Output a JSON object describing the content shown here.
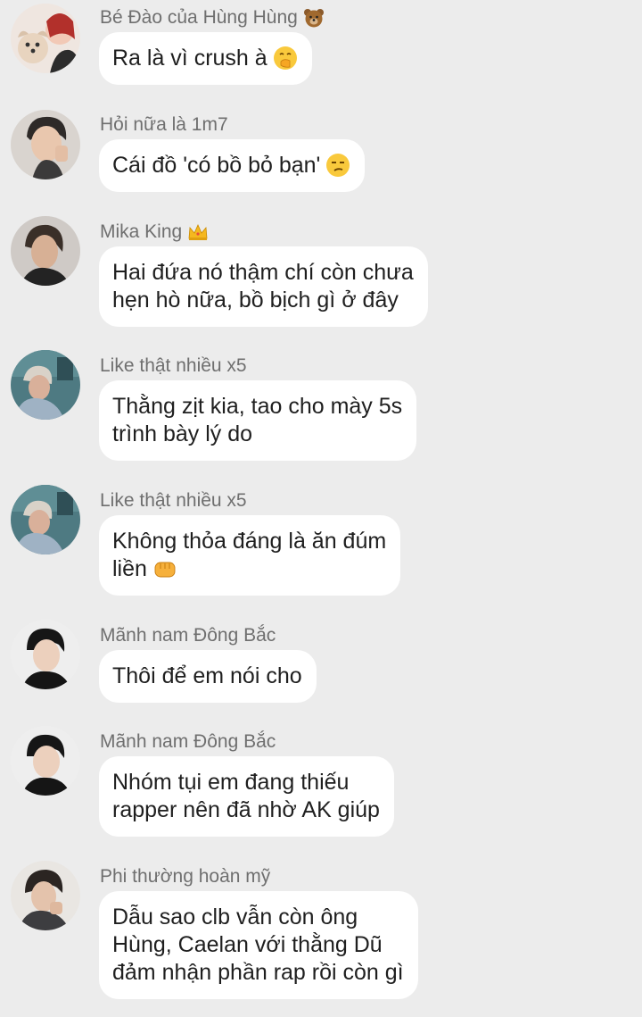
{
  "messages": [
    {
      "sender": "Bé Đào của Hùng Hùng",
      "sender_emoji": "bear-face-icon",
      "lines": [
        "Ra là vì crush à"
      ],
      "trailing_emoji": "face-with-hand-over-mouth-icon"
    },
    {
      "sender": "Hỏi nữa là 1m7",
      "lines": [
        "Cái đồ 'có bồ bỏ bạn'"
      ],
      "trailing_emoji": "unamused-face-icon"
    },
    {
      "sender": "Mika King",
      "sender_emoji": "crown-icon",
      "lines": [
        "Hai đứa nó thậm chí còn chưa",
        "hẹn hò nữa, bồ bịch gì ở đây"
      ]
    },
    {
      "sender": "Like thật nhiều x5",
      "lines": [
        "Thằng zịt kia, tao cho mày 5s",
        "trình bày lý do"
      ]
    },
    {
      "sender": "Like thật nhiều x5",
      "lines": [
        "Không thỏa đáng là ăn đúm",
        "liền"
      ],
      "trailing_emoji": "oncoming-fist-icon"
    },
    {
      "sender": "Mãnh nam Đông Bắc",
      "lines": [
        "Thôi để em nói cho"
      ]
    },
    {
      "sender": "Mãnh nam Đông Bắc",
      "lines": [
        "Nhóm tụi em đang thiếu",
        "rapper nên đã nhờ AK giúp"
      ]
    },
    {
      "sender": "Phi thường hoàn mỹ",
      "lines": [
        "Dẫu sao clb vẫn còn ông",
        "Hùng, Caelan với thằng Dũ",
        "đảm nhận phần rap rồi còn gì"
      ]
    }
  ],
  "colors": {
    "background": "#ececec",
    "bubble": "#ffffff",
    "sender_text": "#6f6f6f",
    "message_text": "#1f1f1f"
  }
}
